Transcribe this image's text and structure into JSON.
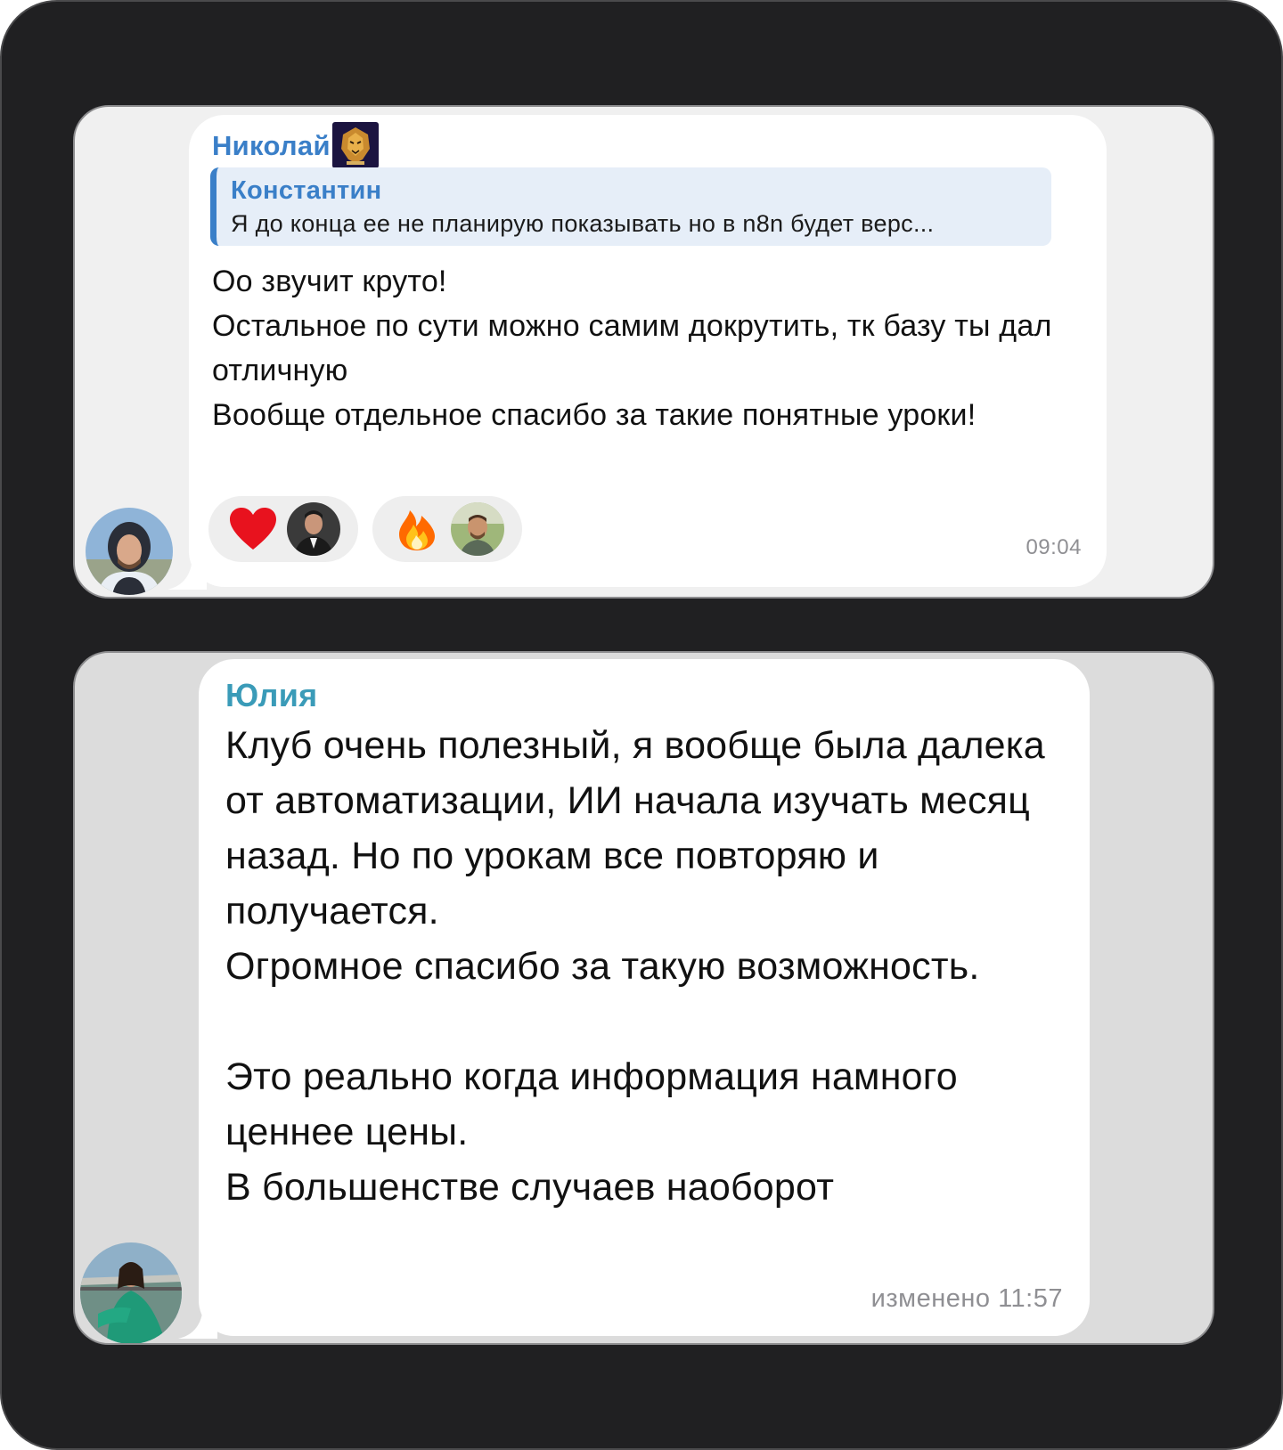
{
  "messages": [
    {
      "sender": "Николай",
      "sender_badge": "tiger-badge-icon",
      "reply": {
        "name": "Константин",
        "text": "Я до конца ее не планирую показывать но в n8n будет верс..."
      },
      "text": "Оо звучит круто!\nОстальное по сути можно самим докрутить, тк базу ты дал отличную\nВообще отдельное спасибо за такие понятные уроки!",
      "reactions": [
        {
          "emoji": "heart-icon",
          "color": "#e8121e"
        },
        {
          "emoji": "fire-icon",
          "color": "#ff6a00"
        }
      ],
      "time": "09:04"
    },
    {
      "sender": "Юлия",
      "text": "Клуб очень полезный, я вообще была далека от автоматизации, ИИ начала изучать месяц назад. Но по урокам все повторяю и получается.\nОгромное спасибо за такую возможность.\n\nЭто реально когда информация намного ценнее цены.\nВ большенстве случаев наоборот",
      "time": "изменено 11:57"
    }
  ],
  "colors": {
    "background": "#202022",
    "sender_1": "#3a7fc8",
    "sender_2": "#3a9bb8",
    "reply_bg": "#e6eef8",
    "time": "#8f8f93"
  }
}
